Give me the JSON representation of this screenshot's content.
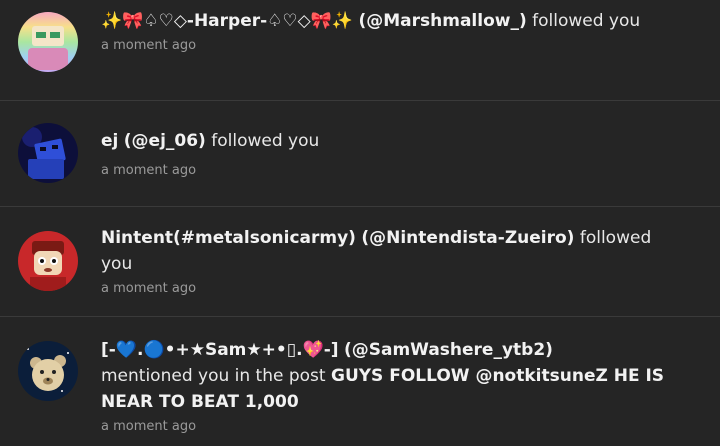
{
  "notifications": [
    {
      "name": "✨🎀♤♡◇-Harper-♤♡◇🎀✨",
      "handle": "(@Marshmallow_)",
      "action": "followed you",
      "time": "a moment ago",
      "avatar_icon": "user-avatar-rainbow"
    },
    {
      "name": "ej",
      "handle": "(@ej_06)",
      "action": "followed you",
      "time": "a moment ago",
      "avatar_icon": "user-avatar-blue-block"
    },
    {
      "name": "Nintent(#metalsonicarmy)",
      "handle": "(@Nintendista-Zueiro)",
      "action": "followed you",
      "time": "a moment ago",
      "avatar_icon": "user-avatar-red-character"
    },
    {
      "name": "[-💙.🔵•+★Sam★+•▯.💖-]",
      "handle": "(@SamWashere_ytb2)",
      "action": "mentioned you in the post",
      "post_title": "GUYS FOLLOW @notkitsuneZ HE IS NEAR TO BEAT 1,000",
      "time": "a moment ago",
      "avatar_icon": "user-avatar-teddy-bear"
    }
  ],
  "colors": {
    "background": "#252525",
    "divider": "#3a3a3a",
    "text": "#e8e8e8",
    "muted": "#9a9a9a"
  }
}
